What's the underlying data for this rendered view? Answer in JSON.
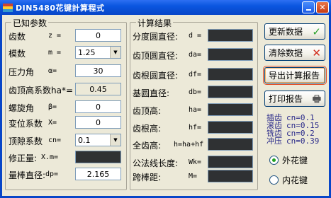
{
  "window": {
    "title": "DIN5480花键計算程式"
  },
  "known": {
    "title": "已知参数",
    "rows": [
      {
        "label": "齿数",
        "symbol": "z =",
        "value": "0",
        "kind": "input"
      },
      {
        "label": "模数",
        "symbol": "m =",
        "value": "1.25",
        "kind": "select"
      },
      {
        "label": "压力角",
        "symbol": "α=",
        "value": "30",
        "kind": "input"
      },
      {
        "label": "齿顶高系数ha*=",
        "symbol": "",
        "value": "0.45",
        "kind": "readonly"
      },
      {
        "label": "螺旋角",
        "symbol": "β=",
        "value": "0",
        "kind": "input"
      },
      {
        "label": "变位系数",
        "symbol": "X=",
        "value": "0",
        "kind": "input"
      },
      {
        "label": "顶隙系数",
        "symbol": "cn=",
        "value": "0.1",
        "kind": "select"
      },
      {
        "label": "修正量:",
        "symbol": "X.m=",
        "value": "",
        "kind": "dark"
      },
      {
        "label": "量棒直径:",
        "symbol": "dp=",
        "value": "2.165",
        "kind": "input"
      }
    ]
  },
  "results": {
    "title": "计算结果",
    "rows": [
      {
        "label": "分度圆直径:",
        "symbol": "d ="
      },
      {
        "label": "齿顶圆直径:",
        "symbol": "da="
      },
      {
        "label": "齿根圆直径:",
        "symbol": "df="
      },
      {
        "label": "基圆直径:",
        "symbol": "db="
      },
      {
        "label": "齿顶高:",
        "symbol": "ha="
      },
      {
        "label": "齿根高:",
        "symbol": "hf="
      },
      {
        "label": "全齿高:",
        "symbol": "h=ha+hf"
      },
      {
        "label": "公法线长度:",
        "symbol": "Wk="
      },
      {
        "label": "跨棒距:",
        "symbol": "M="
      }
    ]
  },
  "buttons": {
    "update": "更新数据",
    "clear": "清除数据",
    "export": "导出计算报告",
    "print": "打印报告"
  },
  "cn_info": [
    {
      "method": "插齿",
      "value": "cn=0.1"
    },
    {
      "method": "滚齿",
      "value": "cn=0.15"
    },
    {
      "method": "铣齿",
      "value": "cn=0.2"
    },
    {
      "method": "冲压",
      "value": "cn=0.39"
    }
  ],
  "spline_type": {
    "options": [
      "外花键",
      "内花键"
    ],
    "selected": "外花键"
  },
  "colors": {
    "titlebar": "#0a56e0",
    "result_box": "#2f3133",
    "check": "#2aa12a",
    "cross": "#d12a1a",
    "cn_text": "#2a2a8a"
  }
}
